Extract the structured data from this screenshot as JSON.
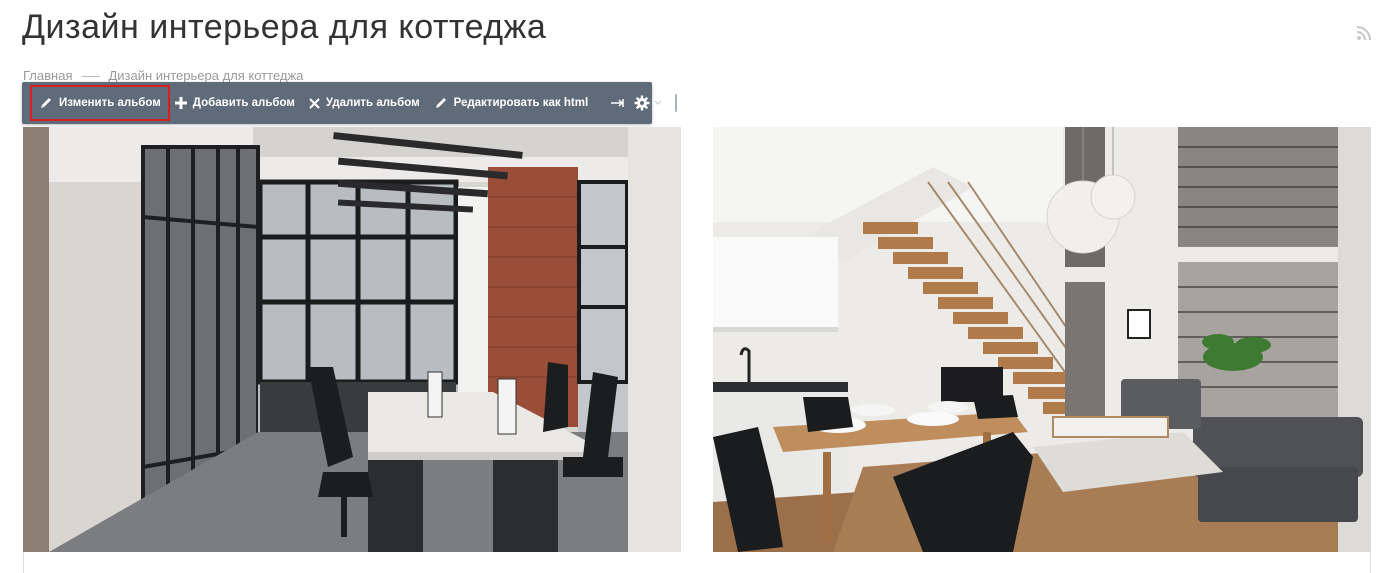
{
  "page": {
    "title": "Дизайн интерьера для коттеджа"
  },
  "breadcrumb": {
    "home": "Главная",
    "current": "Дизайн интерьера для коттеджа"
  },
  "toolbar": {
    "edit_album": "Изменить альбом",
    "add_album": "Добавить альбом",
    "delete_album": "Удалить альбом",
    "edit_html": "Редактировать как html",
    "highlighted_button": "edit_album",
    "highlight_color": "#d42020",
    "background_color": "#5f6b78"
  },
  "icons": {
    "rss": "rss-icon",
    "edit": "pencil-icon",
    "add": "plus-icon",
    "delete": "x-icon",
    "pin": "pin-icon",
    "settings": "gear-icon",
    "menu": "chevron-down-icon"
  },
  "gallery": {
    "images": [
      "office-interior-photo",
      "loft-living-room-photo"
    ]
  }
}
